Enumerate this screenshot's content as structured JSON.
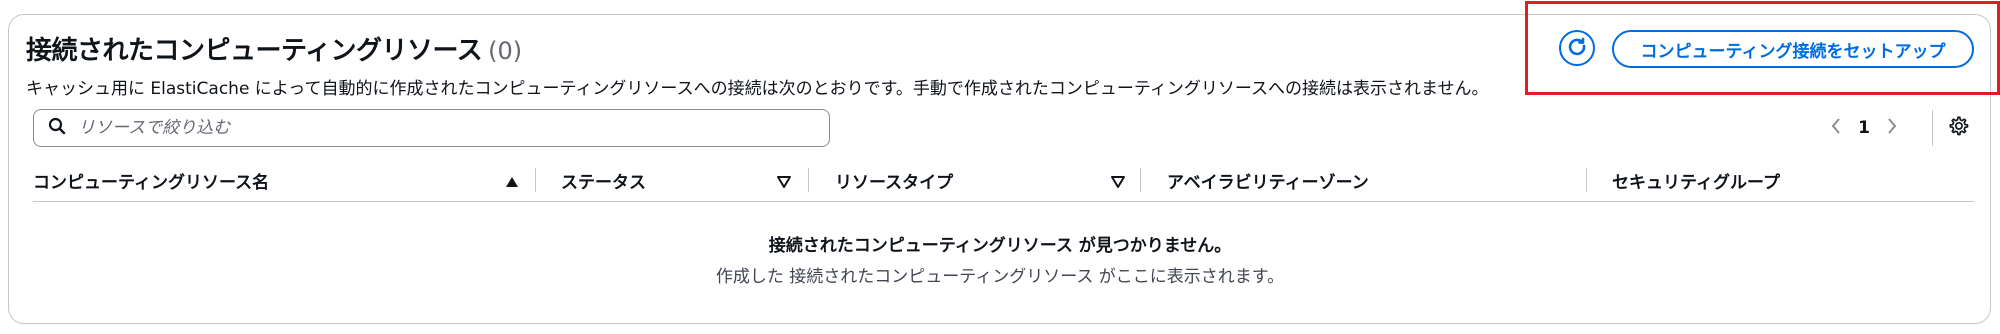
{
  "header": {
    "title": "接続されたコンピューティングリソース",
    "count": "(0)",
    "description": "キャッシュ用に ElastiCache によって自動的に作成されたコンピューティングリソースへの接続は次のとおりです。手動で作成されたコンピューティングリソースへの接続は表示されません。"
  },
  "actions": {
    "refresh_icon": "refresh-icon",
    "setup_label": "コンピューティング接続をセットアップ"
  },
  "search": {
    "placeholder": "リソースで絞り込む",
    "value": ""
  },
  "pagination": {
    "current_page": "1"
  },
  "table": {
    "columns": [
      {
        "label": "コンピューティングリソース名",
        "sort": "ascending"
      },
      {
        "label": "ステータス",
        "sort": "none"
      },
      {
        "label": "リソースタイプ",
        "sort": "none"
      },
      {
        "label": "アベイラビリティーゾーン",
        "sort": "none"
      },
      {
        "label": "セキュリティグループ",
        "sort": "none"
      }
    ],
    "empty_title": "接続されたコンピューティングリソース が見つかりません。",
    "empty_description": "作成した 接続されたコンピューティングリソース がここに表示されます。"
  },
  "colors": {
    "accent": "#006ce0",
    "highlight": "#e31b23",
    "border": "#c6c6cd"
  }
}
